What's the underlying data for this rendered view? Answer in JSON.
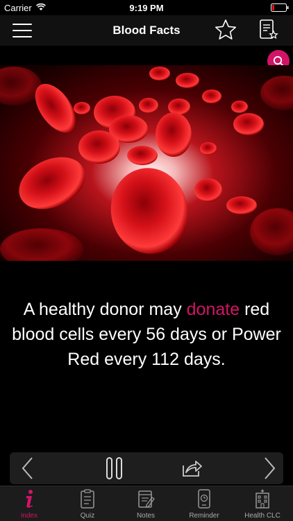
{
  "status_bar": {
    "carrier": "Carrier",
    "time": "9:19 PM"
  },
  "header": {
    "title": "Blood Facts"
  },
  "fact": {
    "text_before": "A healthy donor may ",
    "highlight": "donate",
    "text_after": " red blood cells every 56 days or Power Red every 112 days."
  },
  "tab_bar": {
    "items": [
      {
        "label": "index",
        "icon": "info-icon"
      },
      {
        "label": "Quiz",
        "icon": "quiz-clipboard-icon"
      },
      {
        "label": "Notes",
        "icon": "notes-icon"
      },
      {
        "label": "Reminder",
        "icon": "reminder-phone-icon"
      },
      {
        "label": "Health CLC",
        "icon": "hospital-icon"
      }
    ]
  },
  "colors": {
    "accent": "#d21466",
    "background": "#000000",
    "header": "#111111"
  }
}
